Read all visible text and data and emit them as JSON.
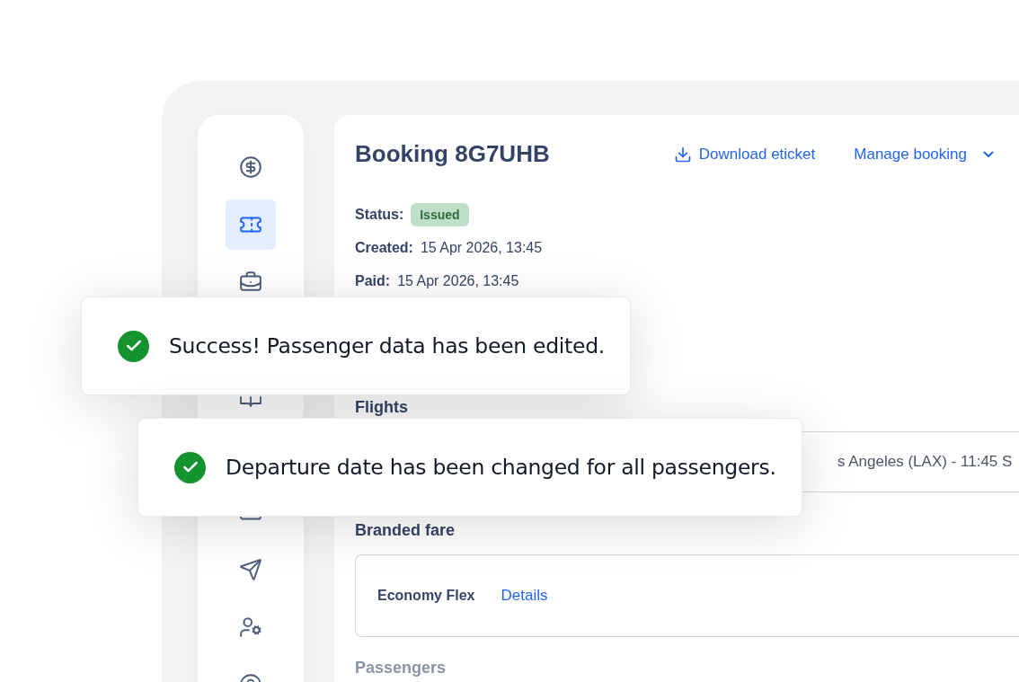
{
  "sidebar": {
    "items": [
      {
        "selected": false
      },
      {
        "selected": true
      },
      {
        "selected": false
      },
      {
        "selected": false
      },
      {
        "selected": false
      },
      {
        "selected": false
      },
      {
        "selected": false
      },
      {
        "selected": false
      }
    ]
  },
  "booking": {
    "title": "Booking 8G7UHB",
    "actions": [
      {
        "label": "Download eticket",
        "kind": "download"
      },
      {
        "label": "Manage booking",
        "kind": "menu"
      }
    ],
    "details": [
      {
        "label": "Status:",
        "value": "Issued",
        "kind": "badge"
      },
      {
        "label": "Created:",
        "value": "15 Apr 2026, 13:45",
        "kind": "text"
      },
      {
        "label": "Paid:",
        "value": "15 Apr 2026, 13:45",
        "kind": "text"
      }
    ],
    "flights": {
      "heading": "Flights",
      "row": "s Angeles (LAX) - 11:45 S"
    },
    "branded_fare": {
      "heading": "Branded fare",
      "name": "Economy Flex",
      "link": "Details"
    },
    "passengers": {
      "heading": "Passengers"
    }
  },
  "toasts": [
    {
      "message": "Success! Passenger data has been edited.",
      "kind": "success"
    },
    {
      "message": "Departure date has been changed for all passengers.",
      "kind": "success"
    }
  ]
}
